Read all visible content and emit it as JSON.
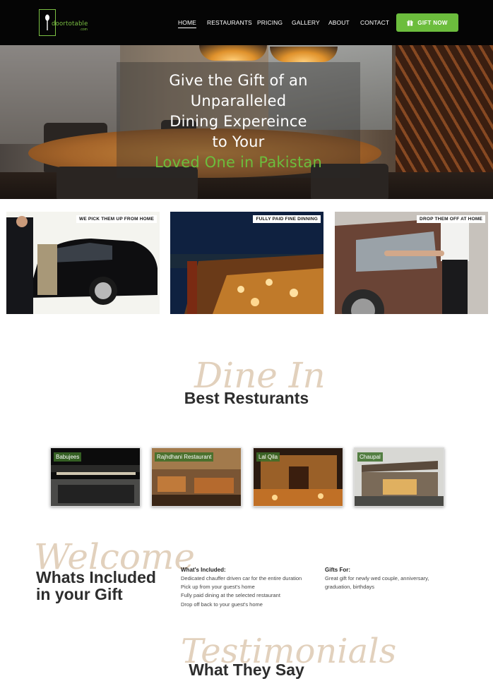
{
  "header": {
    "logo_text": "doortotable",
    "logo_sub": ".com",
    "nav": [
      "HOME",
      "RESTAURANTS",
      "PRICING",
      "GALLERY",
      "ABOUT",
      "CONTACT"
    ],
    "cta": "GIFT NOW"
  },
  "hero": {
    "lines": [
      "Give the Gift of an",
      "Unparalleled",
      "Dining Expereince",
      "to Your",
      "Loved One in Pakistan"
    ]
  },
  "features": [
    {
      "label": "WE PICK THEM UP FROM HOME"
    },
    {
      "label": "FULLY PAID FINE DINNING"
    },
    {
      "label": "DROP THEM OFF AT HOME"
    }
  ],
  "restaurants_section": {
    "script": "Dine In",
    "title": "Best Resturants",
    "items": [
      "Babujees",
      "Rajhdhani Restaurant",
      "Lal Qila",
      "Chaupal"
    ]
  },
  "included_section": {
    "script": "Welcome",
    "title_line1": "Whats Included",
    "title_line2": "in your Gift",
    "included_head": "What's Included:",
    "included_items": [
      "Dedicated chauffer driven car for the entire duration",
      "Pick up from your guest's home",
      "Fully paid dining at the selected restaurant",
      "Drop off back to your guest's home"
    ],
    "gifts_head": "Gifts For:",
    "gifts_items": [
      "Great gift for newly wed couple, anniversary,",
      "graduation, birthdays"
    ]
  },
  "testimonials_section": {
    "script": "Testimonials",
    "title": "What They Say"
  },
  "colors": {
    "accent": "#6cbd3d",
    "header_bg": "#050505"
  }
}
